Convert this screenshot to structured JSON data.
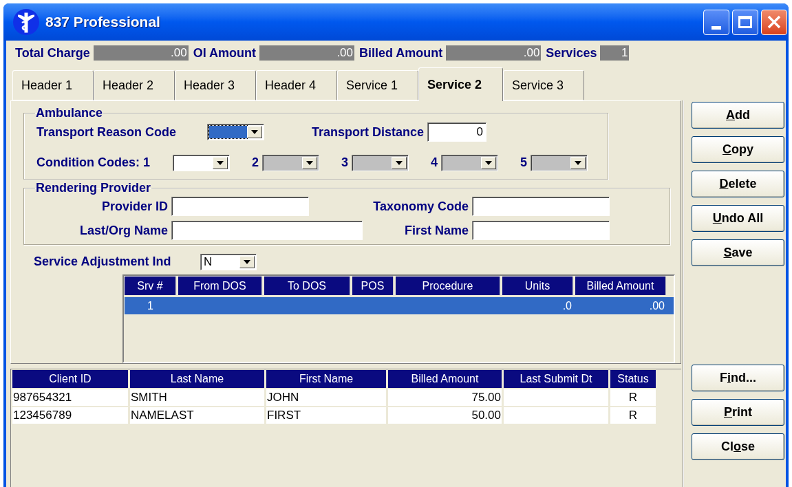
{
  "window": {
    "title": "837 Professional"
  },
  "totals": [
    {
      "label": "Total Charge",
      "value": ".00"
    },
    {
      "label": "OI Amount",
      "value": ".00"
    },
    {
      "label": "Billed Amount",
      "value": ".00"
    },
    {
      "label": "Services",
      "value": "1"
    }
  ],
  "tabs": [
    {
      "label": "Header 1",
      "selected": false
    },
    {
      "label": "Header 2",
      "selected": false
    },
    {
      "label": "Header 3",
      "selected": false
    },
    {
      "label": "Header 4",
      "selected": false
    },
    {
      "label": "Service 1",
      "selected": false
    },
    {
      "label": "Service 2",
      "selected": true
    },
    {
      "label": "Service 3",
      "selected": false
    }
  ],
  "ambulance": {
    "title": "Ambulance",
    "transport_reason_code": {
      "label": "Transport Reason Code",
      "focused": true,
      "disabled": false
    },
    "transport_distance": {
      "label": "Transport Distance",
      "value": "0"
    },
    "condition_codes": [
      {
        "label": "Condition Codes: 1",
        "focused": false,
        "disabled": false
      },
      {
        "label": "2",
        "focused": false,
        "disabled": true
      },
      {
        "label": "3",
        "focused": false,
        "disabled": true
      },
      {
        "label": "4",
        "focused": false,
        "disabled": true
      },
      {
        "label": "5",
        "focused": false,
        "disabled": true
      }
    ]
  },
  "rendering_provider": {
    "title": "Rendering Provider",
    "fields": [
      {
        "label": "Provider ID"
      },
      {
        "label": "Taxonomy Code"
      },
      {
        "label": "Last/Org Name"
      },
      {
        "label": "First Name"
      }
    ]
  },
  "service_adjustment": {
    "label": "Service Adjustment Ind",
    "value": "N",
    "focused": false,
    "disabled": false
  },
  "services_grid": {
    "columns": [
      "Srv #",
      "From DOS",
      "To DOS",
      "POS",
      "Procedure",
      "Units",
      "Billed Amount"
    ],
    "rows": [
      {
        "selected": true,
        "cells": [
          "1",
          null,
          null,
          null,
          null,
          ".0",
          ".00"
        ]
      }
    ]
  },
  "claims": {
    "columns": [
      "Client ID",
      "Last Name",
      "First Name",
      "Billed Amount",
      "Last Submit Dt",
      "Status"
    ],
    "rows": [
      {
        "selected": false,
        "cells": [
          "987654321",
          "SMITH",
          "JOHN",
          "75.00",
          null,
          "R"
        ]
      },
      {
        "selected": false,
        "cells": [
          "123456789",
          "NAMELAST",
          "FIRST",
          "50.00",
          null,
          "R"
        ]
      }
    ]
  },
  "buttons": [
    {
      "label_parts": [
        {
          "text": "A",
          "underlined": true
        },
        {
          "text": "dd",
          "underlined": false
        }
      ]
    },
    {
      "label_parts": [
        {
          "text": "C",
          "underlined": true
        },
        {
          "text": "opy",
          "underlined": false
        }
      ]
    },
    {
      "label_parts": [
        {
          "text": "D",
          "underlined": true
        },
        {
          "text": "elete",
          "underlined": false
        }
      ]
    },
    {
      "label_parts": [
        {
          "text": "U",
          "underlined": true
        },
        {
          "text": "ndo All",
          "underlined": false
        }
      ]
    },
    {
      "label_parts": [
        {
          "text": "S",
          "underlined": true
        },
        {
          "text": "ave",
          "underlined": false
        }
      ]
    }
  ],
  "bottom_buttons": [
    {
      "label_parts": [
        {
          "text": "F",
          "underlined": false
        },
        {
          "text": "i",
          "underlined": true
        },
        {
          "text": "nd...",
          "underlined": false
        }
      ]
    },
    {
      "label_parts": [
        {
          "text": "P",
          "underlined": true
        },
        {
          "text": "rint",
          "underlined": false
        }
      ]
    },
    {
      "label_parts": [
        {
          "text": "Cl",
          "underlined": false
        },
        {
          "text": "o",
          "underlined": true
        },
        {
          "text": "se",
          "underlined": false
        }
      ]
    }
  ]
}
